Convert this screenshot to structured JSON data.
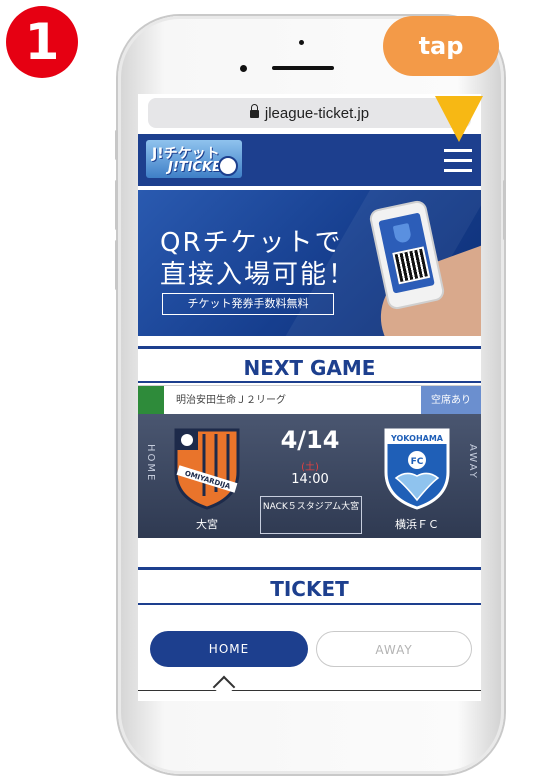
{
  "step_badge": "1",
  "tap_label": "tap",
  "browser": {
    "url": "jleague-ticket.jp"
  },
  "header": {
    "logo_top": "J!チケット",
    "logo_bottom": "J!TICKET"
  },
  "banner": {
    "line1": "QRチケットで",
    "line2": "直接入場可能！",
    "sub": "チケット発券手数料無料"
  },
  "next_game": {
    "title": "NEXT GAME",
    "league": "明治安田生命Ｊ２リーグ",
    "seat_status": "空席あり",
    "home_label": "HOME",
    "away_label": "AWAY",
    "date": "4/14",
    "day": "(土)",
    "time": "14:00",
    "venue": "NACK５スタジアム大宮",
    "home_team": "大宮",
    "away_team": "横浜ＦＣ",
    "home_emblem_text": "OMIYARDIJA",
    "away_emblem_text": "YOKOHAMA",
    "away_emblem_sub": "FC"
  },
  "ticket": {
    "title": "TICKET",
    "home_tab": "HOME",
    "away_tab": "AWAY"
  },
  "colors": {
    "navy": "#1d3f8e",
    "badge_red": "#e60012",
    "tap_orange": "#f39a48",
    "arrow_yellow": "#f7b814",
    "league_green": "#2e8b3a",
    "home_orange": "#e9742b",
    "away_blue": "#1f5fb7"
  }
}
